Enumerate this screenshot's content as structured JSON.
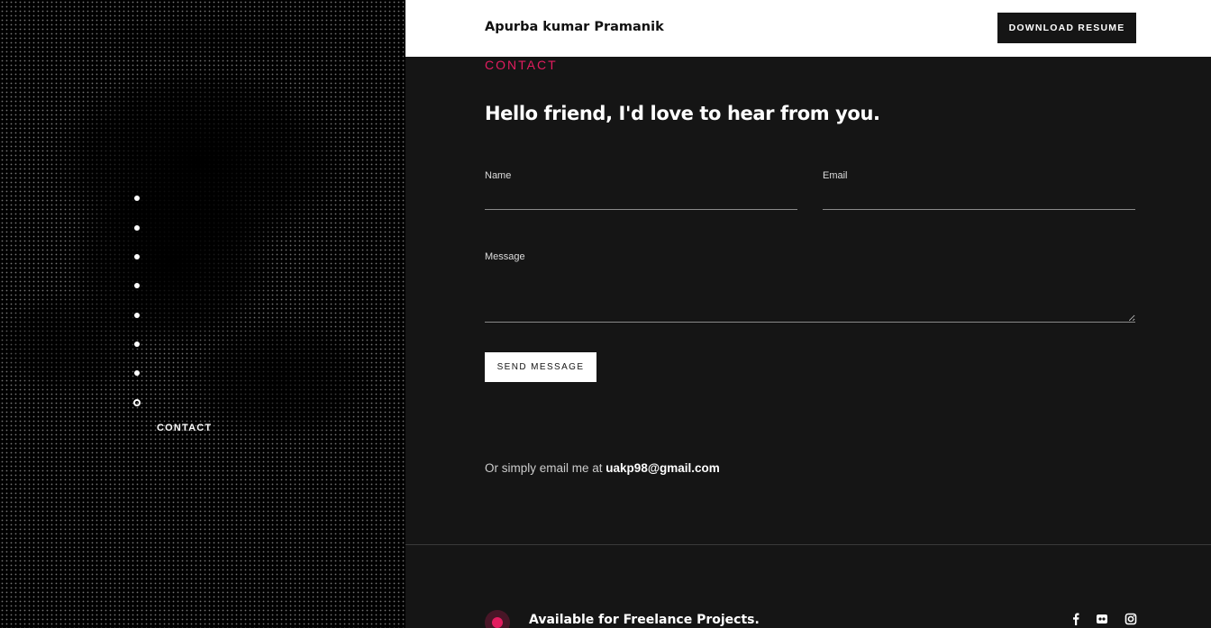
{
  "header": {
    "brand": "Apurba kumar Pramanik",
    "resume_button": "DOWNLOAD RESUME"
  },
  "sidebar": {
    "dots": 8,
    "active_label": "CONTACT"
  },
  "contact": {
    "section_label": "CONTACT",
    "headline": "Hello friend, I'd love to hear from you.",
    "name_label": "Name",
    "email_label": "Email",
    "message_label": "Message",
    "send_button": "SEND MESSAGE",
    "email_prefix": "Or simply email me at",
    "email_address": "uakp98@gmail.com"
  },
  "footer": {
    "availability": "Available for Freelance Projects.",
    "social": [
      "facebook-icon",
      "flickr-icon",
      "instagram-icon"
    ]
  },
  "colors": {
    "accent": "#e31c5f",
    "panel": "#151515",
    "header": "#ffffff"
  }
}
